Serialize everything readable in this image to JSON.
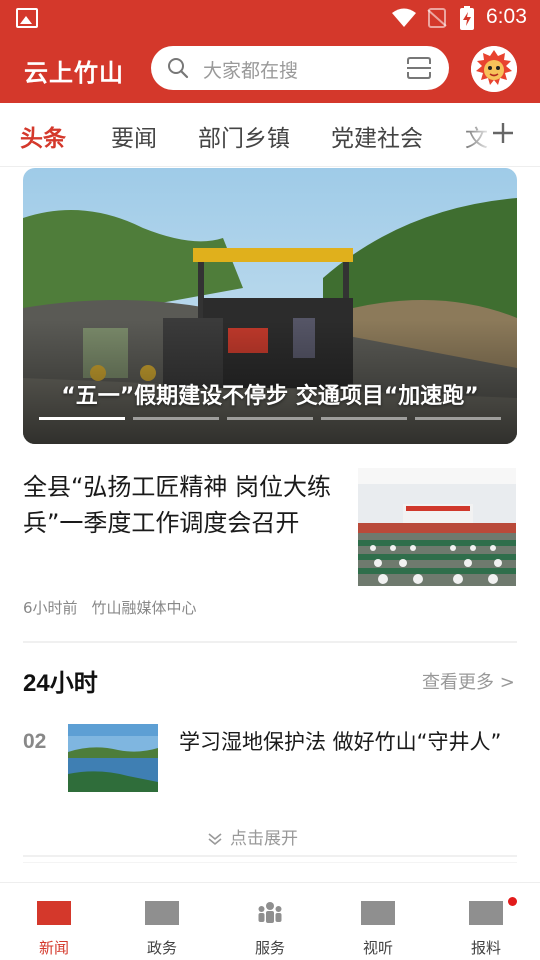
{
  "status_bar": {
    "time": "6:03"
  },
  "header": {
    "brand": "云上竹山",
    "search_placeholder": "大家都在搜"
  },
  "tabs": [
    {
      "label": "头条",
      "active": true
    },
    {
      "label": "要闻"
    },
    {
      "label": "部门乡镇"
    },
    {
      "label": "党建社会"
    },
    {
      "label": "文"
    }
  ],
  "banner": {
    "caption": "“五一”假期建设不停步  交通项目“加速跑”",
    "page_count": 5,
    "current_page": 1
  },
  "article": {
    "title": "全县“弘扬工匠精神 岗位大练兵”一季度工作调度会召开",
    "time": "6小时前",
    "source": "竹山融媒体中心"
  },
  "section_24h": {
    "title": "24小时",
    "more_label": "查看更多 >",
    "items": [
      {
        "rank": "02",
        "title": "学习湿地保护法 做好竹山“守井人”"
      }
    ],
    "expand_label": "点击展开"
  },
  "bottom_nav": [
    {
      "label": "新闻",
      "active": true
    },
    {
      "label": "政务"
    },
    {
      "label": "服务"
    },
    {
      "label": "视听"
    },
    {
      "label": "报料",
      "badge": true
    }
  ],
  "colors": {
    "brand_red": "#d4382b",
    "inactive_icon": "#8f8f8f",
    "badge_red": "#e21b1b"
  },
  "icons": [
    "image-icon",
    "wifi-icon",
    "no-signal-icon",
    "battery-icon",
    "search-icon",
    "scan-icon",
    "plus-icon",
    "chevron-down-icon",
    "people-icon"
  ]
}
